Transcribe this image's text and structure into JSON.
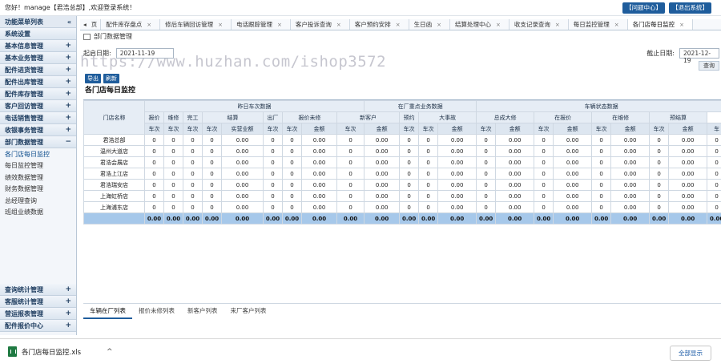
{
  "topbar": {
    "greeting": "您好！manage【君浩总部】,欢迎登录系统！",
    "help_button": "【问题中心】",
    "logout_button": "【退出系统】"
  },
  "sidebar": {
    "header": "功能菜单列表",
    "collapse_icon": "«",
    "system_settings": "系统设置",
    "categories_top": [
      {
        "label": "基本信息管理",
        "toggle": "+"
      },
      {
        "label": "基本业务管理",
        "toggle": "+"
      },
      {
        "label": "配件进货管理",
        "toggle": "+"
      },
      {
        "label": "配件出库管理",
        "toggle": "+"
      },
      {
        "label": "配件库存管理",
        "toggle": "+"
      },
      {
        "label": "客户回访管理",
        "toggle": "+"
      },
      {
        "label": "电话销售管理",
        "toggle": "+"
      },
      {
        "label": "收银事务管理",
        "toggle": "+"
      },
      {
        "label": "部门数据管理",
        "toggle": "−"
      }
    ],
    "sub_items": [
      "各门店每日监控",
      "每日监控管理",
      "绩效数据管理",
      "财务数据管理",
      "总经理查询",
      "班组业绩数据"
    ],
    "categories_bottom": [
      {
        "label": "查询统计管理",
        "toggle": "+"
      },
      {
        "label": "客服统计管理",
        "toggle": "+"
      },
      {
        "label": "营运报表管理",
        "toggle": "+"
      },
      {
        "label": "配件报价中心",
        "toggle": "+"
      }
    ]
  },
  "tabs": {
    "nav_left": "◂",
    "nav_label": "页",
    "items": [
      "配件库存盘点",
      "修后车辆回访管理",
      "电话跟踪管理",
      "客户投诉查询",
      "客户预约安排",
      "生日函",
      "结算处理中心",
      "收支记录查询",
      "每日监控管理",
      "各门店每日监控"
    ],
    "close_icon": "×"
  },
  "content": {
    "breadcrumb": "部门数据管理",
    "watermark": "https://www.huzhan.com/ishop3572",
    "start_label": "起启日期:",
    "start_value": "2021-11-19",
    "end_label": "截止日期:",
    "end_value": "2021-12-19",
    "query_button": "查询",
    "export_button": "导出",
    "refresh_button": "刷新",
    "title": "各门店每日监控"
  },
  "table": {
    "group_headers": [
      "门店名称",
      "昨日车次数据",
      "在厂重点业务数据",
      "车辆状态数据"
    ],
    "sub_headers": [
      "报价",
      "维修",
      "完工",
      "结算",
      "出厂",
      "报价未修",
      "新客户",
      "预约",
      "大事故",
      "总成大修",
      "在报价",
      "在维修",
      "预结算"
    ],
    "leaf_headers": [
      "车次",
      "车次",
      "车次",
      "车次",
      "实营业额",
      "车次",
      "车次",
      "金额",
      "车次",
      "金额",
      "车次",
      "车次",
      "金额",
      "车次",
      "金额",
      "车次",
      "金额",
      "车次",
      "金额",
      "车次",
      "金额",
      "车"
    ],
    "rows": [
      {
        "name": "君浩总部",
        "values": [
          "0",
          "0",
          "0",
          "0",
          "0.00",
          "0",
          "0",
          "0.00",
          "0",
          "0.00",
          "0",
          "0",
          "0.00",
          "0",
          "0.00",
          "0",
          "0.00",
          "0",
          "0.00",
          "0",
          "0.00",
          "0"
        ]
      },
      {
        "name": "温州大道店",
        "values": [
          "0",
          "0",
          "0",
          "0",
          "0.00",
          "0",
          "0",
          "0.00",
          "0",
          "0.00",
          "0",
          "0",
          "0.00",
          "0",
          "0.00",
          "0",
          "0.00",
          "0",
          "0.00",
          "0",
          "0.00",
          "0"
        ]
      },
      {
        "name": "君浩会展店",
        "values": [
          "0",
          "0",
          "0",
          "0",
          "0.00",
          "0",
          "0",
          "0.00",
          "0",
          "0.00",
          "0",
          "0",
          "0.00",
          "0",
          "0.00",
          "0",
          "0.00",
          "0",
          "0.00",
          "0",
          "0.00",
          "0"
        ]
      },
      {
        "name": "君浩上江店",
        "values": [
          "0",
          "0",
          "0",
          "0",
          "0.00",
          "0",
          "0",
          "0.00",
          "0",
          "0.00",
          "0",
          "0",
          "0.00",
          "0",
          "0.00",
          "0",
          "0.00",
          "0",
          "0.00",
          "0",
          "0.00",
          "0"
        ]
      },
      {
        "name": "君浩瑞安店",
        "values": [
          "0",
          "0",
          "0",
          "0",
          "0.00",
          "0",
          "0",
          "0.00",
          "0",
          "0.00",
          "0",
          "0",
          "0.00",
          "0",
          "0.00",
          "0",
          "0.00",
          "0",
          "0.00",
          "0",
          "0.00",
          "0"
        ]
      },
      {
        "name": "上海虹桥店",
        "values": [
          "0",
          "0",
          "0",
          "0",
          "0.00",
          "0",
          "0",
          "0.00",
          "0",
          "0.00",
          "0",
          "0",
          "0.00",
          "0",
          "0.00",
          "0",
          "0.00",
          "0",
          "0.00",
          "0",
          "0.00",
          "0"
        ]
      },
      {
        "name": "上海浦东店",
        "values": [
          "0",
          "0",
          "0",
          "0",
          "0.00",
          "0",
          "0",
          "0.00",
          "0",
          "0.00",
          "0",
          "0",
          "0.00",
          "0",
          "0.00",
          "0",
          "0.00",
          "0",
          "0.00",
          "0",
          "0.00",
          "0"
        ]
      }
    ],
    "summary": [
      "0.00",
      "0.00",
      "0.00",
      "0.00",
      "0.00",
      "0.00",
      "0.00",
      "0.00",
      "0.00",
      "0.00",
      "0.00",
      "0.00",
      "0.00",
      "0.00",
      "0.00",
      "0.00",
      "0.00",
      "0.00",
      "0.00",
      "0.00",
      "0.00",
      "0.00"
    ]
  },
  "bottom_tabs": [
    "车辆在厂列表",
    "报价未修列表",
    "新客户列表",
    "来厂客户列表"
  ],
  "download_bar": {
    "file_name": "各门店每日监控.xls",
    "chevron": "^",
    "show_all": "全部显示"
  },
  "colors": {
    "primary": "#1f5d9c",
    "summary_row": "#a6c8ea",
    "header_bg": "#e6edf5",
    "xls_icon": "#1f7a42"
  },
  "icons": {
    "file_icon": "excel-file-icon",
    "home_icon": "home-icon"
  }
}
